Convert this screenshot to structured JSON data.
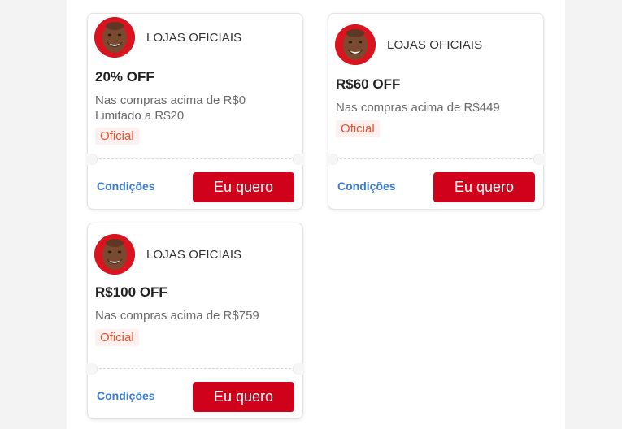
{
  "coupons": [
    {
      "store": "LOJAS OFICIAIS",
      "discount": "20% OFF",
      "condition": "Nas compras acima de R$0",
      "limit": "Limitado a R$20",
      "badge": "Oficial",
      "conditions_label": "Condições",
      "cta_label": "Eu quero"
    },
    {
      "store": "LOJAS OFICIAIS",
      "discount": "R$60 OFF",
      "condition": "Nas compras acima de R$449",
      "badge": "Oficial",
      "conditions_label": "Condições",
      "cta_label": "Eu quero"
    },
    {
      "store": "LOJAS OFICIAIS",
      "discount": "R$100 OFF",
      "condition": "Nas compras acima de R$759",
      "badge": "Oficial",
      "conditions_label": "Condições",
      "cta_label": "Eu quero"
    }
  ],
  "colors": {
    "brand_red": "#d0021b",
    "link_blue": "#3a7bd5",
    "badge_text": "#e2542f",
    "badge_bg": "#fdf0ee"
  },
  "icons": {
    "store_avatar": "store-avatar-photo"
  }
}
